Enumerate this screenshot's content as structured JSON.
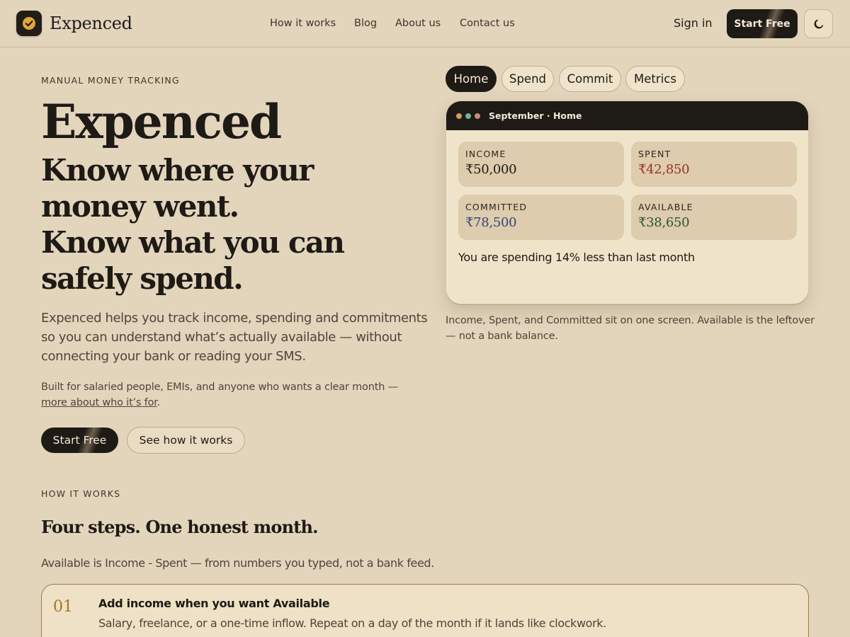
{
  "header": {
    "brand": "Expenced",
    "nav": [
      "How it works",
      "Blog",
      "About us",
      "Contact us"
    ],
    "sign_in": "Sign in",
    "start_free": "Start Free"
  },
  "hero": {
    "eyebrow": "MANUAL MONEY TRACKING",
    "title": "Expenced",
    "subtitle_lines": [
      "Know where your",
      "money went.",
      "Know what you can",
      "safely spend."
    ],
    "description_lines": [
      "Expenced helps you track income, spending and commitments",
      "so you can understand what’s actually available — without",
      "connecting your bank or reading your SMS."
    ],
    "built_text": "Built for salaried people, EMIs, and anyone who wants a clear month —",
    "built_link": "more about who it’s for",
    "built_end": ".",
    "cta_primary": "Start Free",
    "cta_secondary": "See how it works"
  },
  "preview": {
    "tabs": [
      "Home",
      "Spend",
      "Commit",
      "Metrics"
    ],
    "active_tab": "Home",
    "card_title": "September · Home",
    "tiles": [
      {
        "label": "INCOME",
        "value": "₹50,000",
        "color": "#1e1a15"
      },
      {
        "label": "SPENT",
        "value": "₹42,850",
        "color": "#9a2e24"
      },
      {
        "label": "COMMITTED",
        "value": "₹78,500",
        "color": "#33467a"
      },
      {
        "label": "AVAILABLE",
        "value": "₹38,650",
        "color": "#2c5338"
      }
    ],
    "note": "You are spending 14% less than last month",
    "caption_lines": [
      "Income, Spent, and Committed sit on one screen. Available is the leftover",
      "— not a bank balance."
    ]
  },
  "how": {
    "eyebrow": "HOW IT WORKS",
    "title": "Four steps. One honest month.",
    "description": "Available is Income - Spent — from numbers you typed, not a bank feed.",
    "steps": [
      {
        "number": "01",
        "title": "Add income when you want Available",
        "description": "Salary, freelance, or a one-time inflow. Repeat on a day of the month if it lands like clockwork."
      }
    ]
  },
  "colors": {
    "background": "#e3d5bc",
    "ink": "#1e1a15",
    "accent_gold": "#e0a63f",
    "step_number": "#a2752f",
    "spent": "#9a2e24",
    "committed": "#33467a",
    "available": "#2c5338"
  },
  "icons": {
    "logo": "check-badge-icon",
    "theme_toggle": "moon-icon"
  }
}
